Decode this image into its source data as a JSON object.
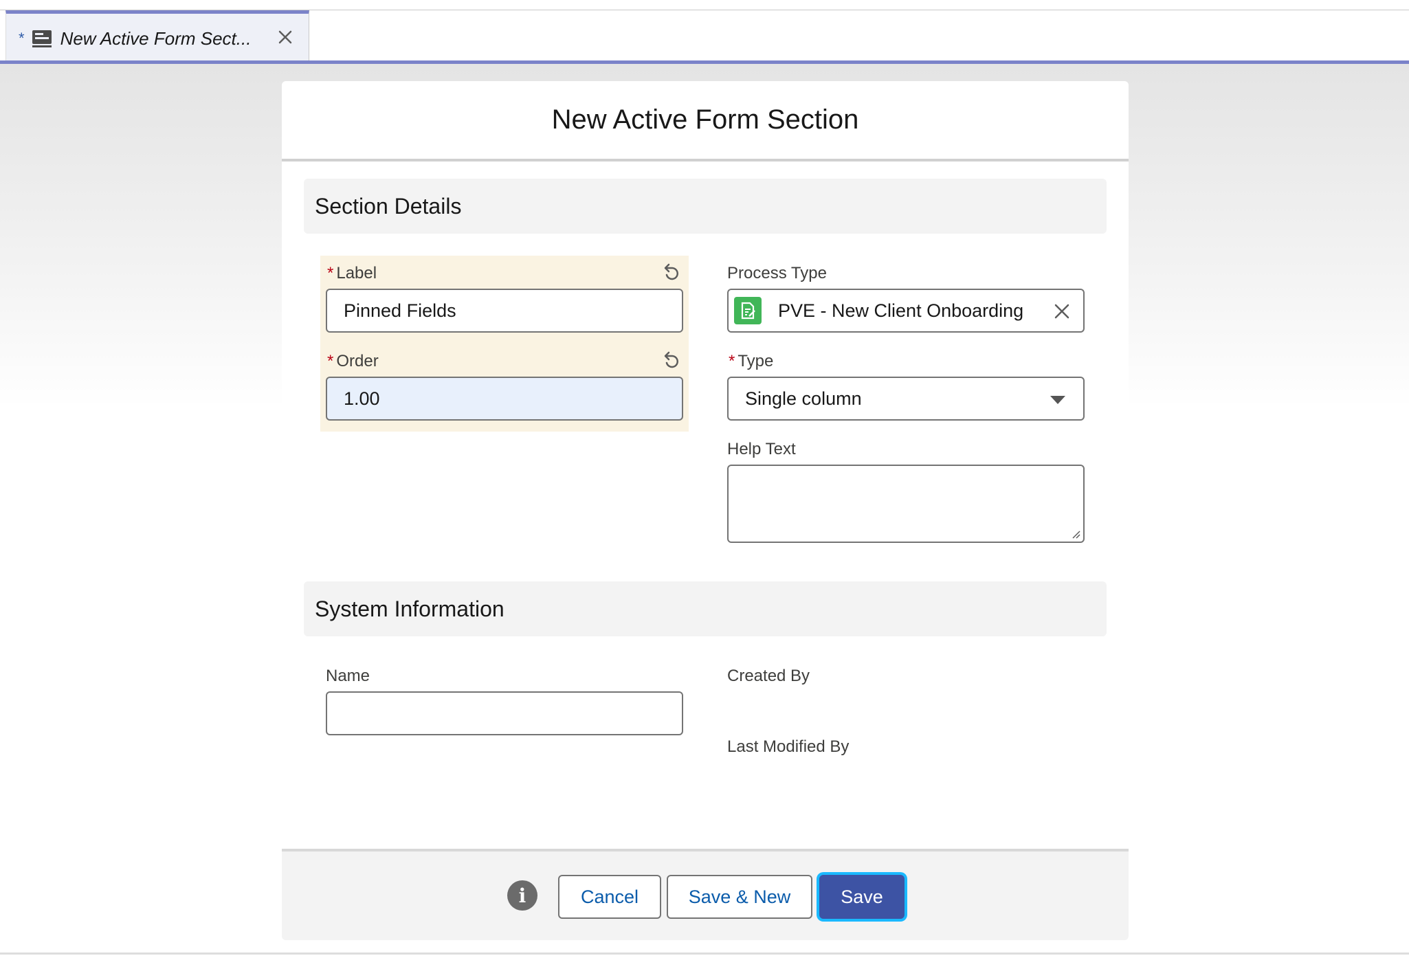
{
  "tab": {
    "dirty_marker": "*",
    "title": "New Active Form Sect...",
    "icon": "record-form-icon"
  },
  "modal": {
    "title": "New Active Form Section",
    "sections": {
      "details": "Section Details",
      "system": "System Information"
    }
  },
  "fields": {
    "label": {
      "label": "Label",
      "required": "*",
      "value": "Pinned Fields"
    },
    "order": {
      "label": "Order",
      "required": "*",
      "value": "1.00"
    },
    "process_type": {
      "label": "Process Type",
      "value": "PVE - New Client Onboarding"
    },
    "type": {
      "label": "Type",
      "required": "*",
      "value": "Single column"
    },
    "help_text": {
      "label": "Help Text",
      "value": ""
    },
    "name": {
      "label": "Name",
      "value": ""
    },
    "created_by": {
      "label": "Created By"
    },
    "last_modified_by": {
      "label": "Last Modified By"
    }
  },
  "footer": {
    "cancel": "Cancel",
    "save_new": "Save & New",
    "save": "Save"
  },
  "colors": {
    "brand": "#3d53a4",
    "focus_ring": "#1ab9ff",
    "required": "#ba0517",
    "edited_bg": "#faf3e2",
    "lookup_icon_bg": "#41b658"
  }
}
